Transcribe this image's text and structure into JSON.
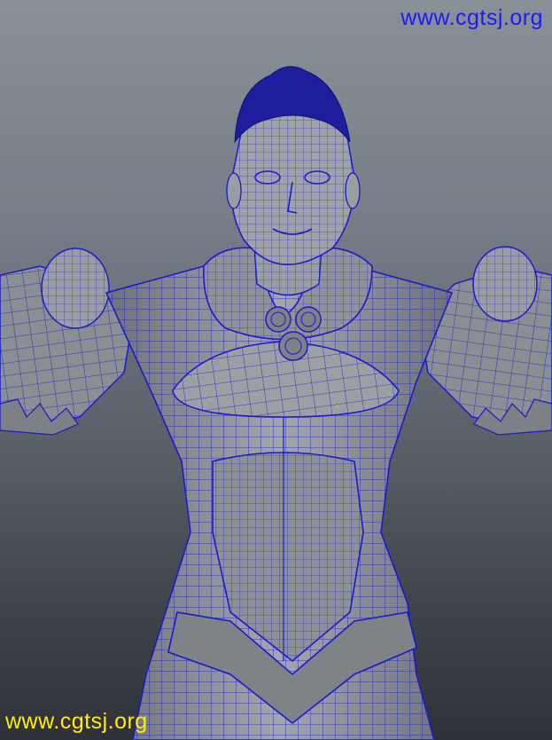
{
  "watermark_top": {
    "text": "www.cgtsj.org",
    "color": "#1a1aff"
  },
  "watermark_bottom": {
    "text": "www.cgtsj.org",
    "color": "#ffee00"
  },
  "viewport": {
    "background_top": "#8a9097",
    "background_bottom": "#2e3238",
    "mesh_fill": "#8e9196",
    "wire_color": "#1010c8"
  },
  "model_icon": "wireframe-character-mesh"
}
